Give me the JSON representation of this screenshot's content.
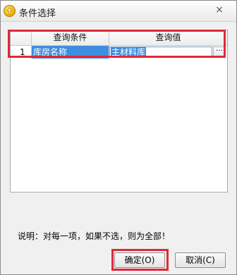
{
  "window": {
    "title": "条件选择",
    "close_glyph": "×"
  },
  "grid": {
    "columns": [
      "查询条件",
      "查询值"
    ],
    "rows": [
      {
        "index": "1",
        "condition": "库房名称",
        "value": "主材料库",
        "button": "···"
      }
    ]
  },
  "note": "说明：对每一项，如果不选，则为全部！",
  "buttons": {
    "ok": "确定(O)",
    "cancel": "取消(C)"
  },
  "colors": {
    "highlight": "#3f8de0",
    "annotation_red": "#e0283a"
  }
}
